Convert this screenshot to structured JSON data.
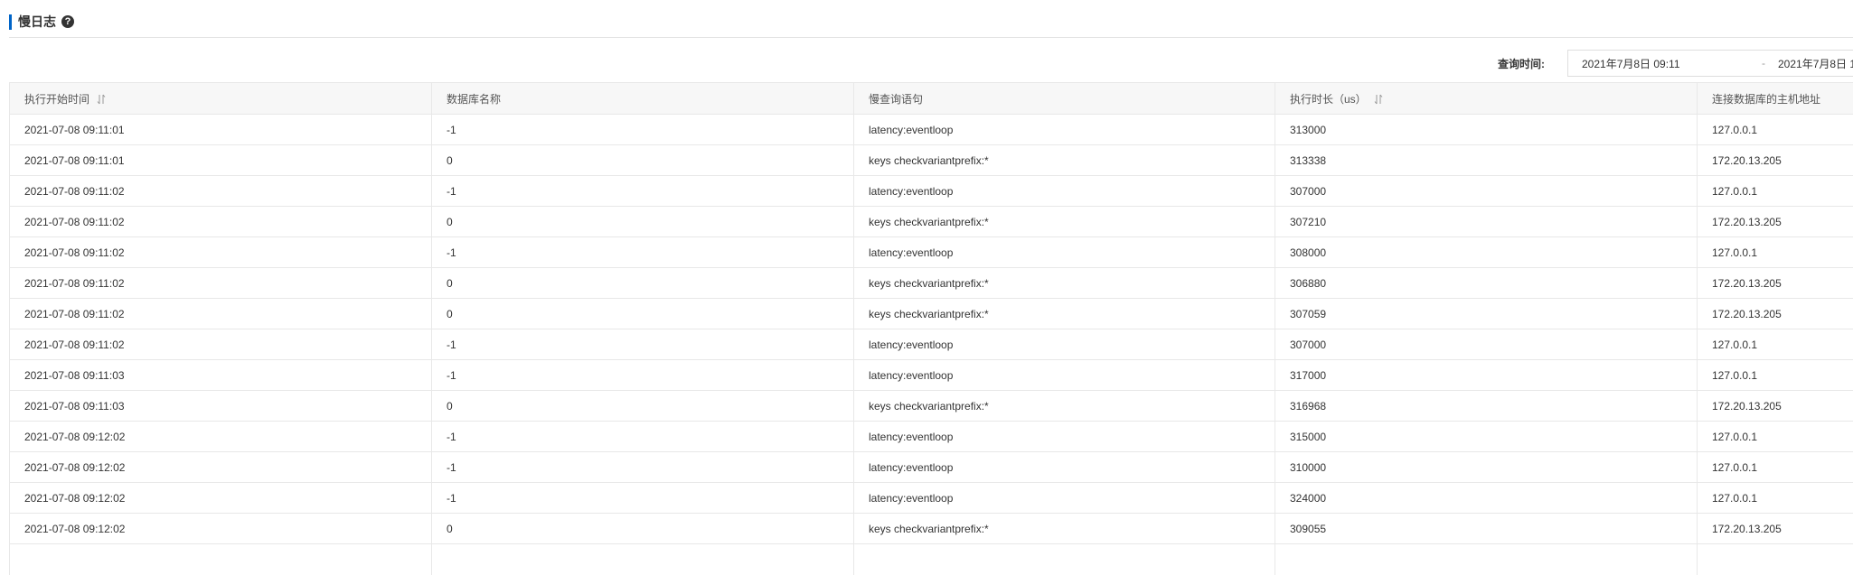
{
  "header": {
    "title": "慢日志",
    "help_icon": "?"
  },
  "filter": {
    "label": "查询时间:",
    "start": "2021年7月8日 09:11",
    "separator": "-",
    "end": "2021年7月8日 1"
  },
  "table": {
    "columns": [
      {
        "label": "执行开始时间",
        "sortable": true
      },
      {
        "label": "数据库名称",
        "sortable": false
      },
      {
        "label": "慢查询语句",
        "sortable": false
      },
      {
        "label": "执行时长（us）",
        "sortable": true
      },
      {
        "label": "连接数据库的主机地址",
        "sortable": false
      }
    ],
    "rows": [
      [
        "2021-07-08 09:11:01",
        "-1",
        "latency:eventloop",
        "313000",
        "127.0.0.1"
      ],
      [
        "2021-07-08 09:11:01",
        "0",
        "keys checkvariantprefix:*",
        "313338",
        "172.20.13.205"
      ],
      [
        "2021-07-08 09:11:02",
        "-1",
        "latency:eventloop",
        "307000",
        "127.0.0.1"
      ],
      [
        "2021-07-08 09:11:02",
        "0",
        "keys checkvariantprefix:*",
        "307210",
        "172.20.13.205"
      ],
      [
        "2021-07-08 09:11:02",
        "-1",
        "latency:eventloop",
        "308000",
        "127.0.0.1"
      ],
      [
        "2021-07-08 09:11:02",
        "0",
        "keys checkvariantprefix:*",
        "306880",
        "172.20.13.205"
      ],
      [
        "2021-07-08 09:11:02",
        "0",
        "keys checkvariantprefix:*",
        "307059",
        "172.20.13.205"
      ],
      [
        "2021-07-08 09:11:02",
        "-1",
        "latency:eventloop",
        "307000",
        "127.0.0.1"
      ],
      [
        "2021-07-08 09:11:03",
        "-1",
        "latency:eventloop",
        "317000",
        "127.0.0.1"
      ],
      [
        "2021-07-08 09:11:03",
        "0",
        "keys checkvariantprefix:*",
        "316968",
        "172.20.13.205"
      ],
      [
        "2021-07-08 09:12:02",
        "-1",
        "latency:eventloop",
        "315000",
        "127.0.0.1"
      ],
      [
        "2021-07-08 09:12:02",
        "-1",
        "latency:eventloop",
        "310000",
        "127.0.0.1"
      ],
      [
        "2021-07-08 09:12:02",
        "-1",
        "latency:eventloop",
        "324000",
        "127.0.0.1"
      ],
      [
        "2021-07-08 09:12:02",
        "0",
        "keys checkvariantprefix:*",
        "309055",
        "172.20.13.205"
      ],
      [
        "",
        "",
        "",
        "",
        ""
      ]
    ]
  },
  "colors": {
    "accent": "#0064c8",
    "header_bg": "#f7f7f7",
    "border": "#e8e8e8"
  }
}
